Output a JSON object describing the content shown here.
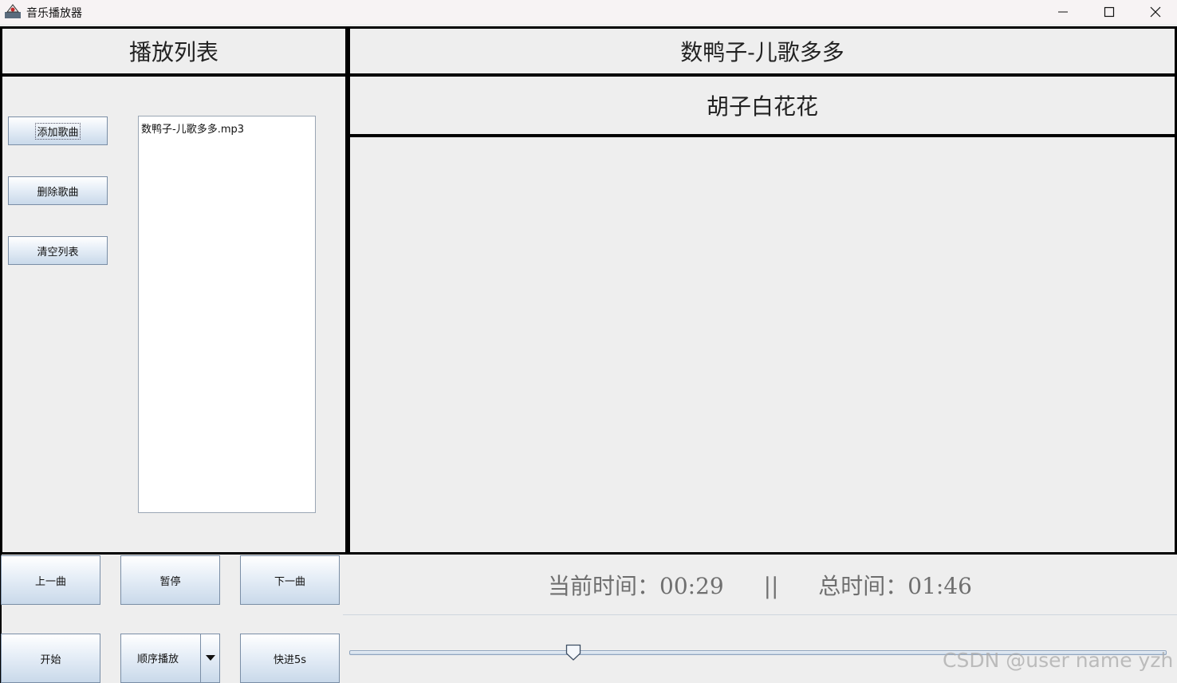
{
  "window": {
    "title": "音乐播放器",
    "icons": {
      "app": "music-player-icon",
      "minimize": "minimize-icon",
      "maximize": "maximize-icon",
      "close": "close-icon"
    }
  },
  "playlist": {
    "header": "播放列表",
    "buttons": {
      "add": "添加歌曲",
      "delete": "删除歌曲",
      "clear": "清空列表"
    },
    "items": [
      "数鸭子-儿歌多多.mp3"
    ]
  },
  "now_playing": {
    "song_title": "数鸭子-儿歌多多",
    "artist": "胡子白花花"
  },
  "controls": {
    "prev": "上一曲",
    "pause": "暂停",
    "next": "下一曲",
    "start": "开始",
    "mode": "顺序播放",
    "fast_forward": "快进5s"
  },
  "time": {
    "current_label": "当前时间：",
    "current": "00:29",
    "separator": "||",
    "total_label": "总时间：",
    "total": "01:46"
  },
  "progress": {
    "fraction": 0.273
  },
  "watermark": "CSDN @user name yzh",
  "colors": {
    "border": "#000000",
    "panel_bg": "#eeeeee",
    "button_top": "#ffffff",
    "button_bottom": "#c9d9ea",
    "time_text": "#6f6f6f"
  }
}
